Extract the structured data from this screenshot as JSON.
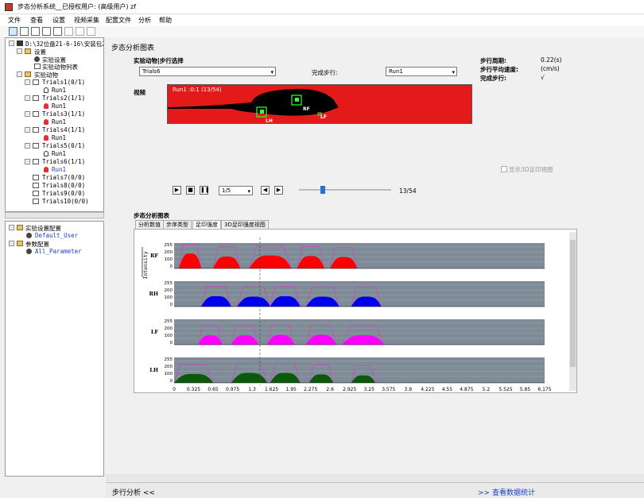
{
  "window": {
    "title": "步态分析系统__已授权用户: (高级用户) zf"
  },
  "menu": [
    "文件",
    "查看",
    "设置",
    "视频采集",
    "配置文件",
    "分析",
    "帮助"
  ],
  "tree": {
    "root_path": "D:\\32位盘21-6-16\\安装包21-",
    "settings": "设置",
    "exp_settings": "实验设置",
    "exp_animal_list": "实验动物列表",
    "exp_animals": "实验动物",
    "trials": [
      {
        "label": "Trials1(0/1)",
        "run": "Run1",
        "state": "white"
      },
      {
        "label": "Trials2(1/1)",
        "run": "Run1",
        "state": "red"
      },
      {
        "label": "Trials3(1/1)",
        "run": "Run1",
        "state": "red"
      },
      {
        "label": "Trials4(1/1)",
        "run": "Run1",
        "state": "red"
      },
      {
        "label": "Trials5(0/1)",
        "run": "Run1",
        "state": "white"
      },
      {
        "label": "Trials6(1/1)",
        "run": "Run1",
        "state": "red",
        "selected": true
      }
    ],
    "trials_empty": [
      "Trials7(0/0)",
      "Trials8(0/0)",
      "Trials9(0/0)",
      "Trials10(0/0)"
    ]
  },
  "tree2": {
    "exp_config": "实验设置配置",
    "default_user": "Default_User",
    "param_config": "参数配置",
    "all_param": "All_Parameter"
  },
  "main": {
    "section_title": "步态分析图表",
    "animal_label": "实验动物|步行选择",
    "animal_value": "Trials6",
    "finished_label": "完成步行:",
    "finished_value": "Run1",
    "stats": [
      {
        "label": "步行周期:",
        "value": "0.22(s)"
      },
      {
        "label": "步行平均速度:",
        "value": "(cm/s)"
      },
      {
        "label": "完成步行:",
        "value": "√"
      }
    ],
    "video_label": "视频",
    "video_caption": "Run1 :0:1 (13/54)",
    "paw_labels": [
      "RF",
      "LH",
      "LF"
    ],
    "show_3d": "显示3D足印视图",
    "speed_value": "1/5",
    "frame_counter": "13/54",
    "progress": 0.23,
    "chart_section": "步态分析图表",
    "tabs": [
      "分析数值",
      "步序类型",
      "足印强度",
      "3D足印强度视图"
    ],
    "active_tab": 2
  },
  "status": {
    "left": "步行分析 <<",
    "right": ">> 查看数据统计"
  },
  "chart_data": {
    "type": "area",
    "ylabel": "Intensity",
    "yticks": [
      "255",
      "200",
      "100",
      "0"
    ],
    "x_ticks": [
      "0",
      "0.325",
      "0.65",
      "0.975",
      "1.3",
      "1.625",
      "1.95",
      "2.275",
      "2.6",
      "2.925",
      "3.25",
      "3.575",
      "3.9",
      "4.225",
      "4.55",
      "4.875",
      "5.2",
      "5.525",
      "5.85",
      "6.175"
    ],
    "xlim": [
      0,
      6.175
    ],
    "marker_x": 1.43,
    "colors": {
      "RF": "#ff0000",
      "RH": "#0000ee",
      "LF": "#ff00ff",
      "LH": "#0b5a0b",
      "bg": "#7f8c97",
      "envelope": "#cc44cc"
    },
    "series": [
      {
        "name": "RF",
        "contacts": [
          [
            0.08,
            0.45,
            150
          ],
          [
            0.65,
            1.1,
            120
          ],
          [
            1.25,
            1.95,
            130
          ],
          [
            2.05,
            2.5,
            125
          ],
          [
            2.6,
            3.05,
            115
          ]
        ]
      },
      {
        "name": "RH",
        "contacts": [
          [
            0.45,
            0.95,
            105
          ],
          [
            1.05,
            1.6,
            100
          ],
          [
            1.6,
            2.1,
            105
          ],
          [
            2.2,
            2.75,
            100
          ],
          [
            2.95,
            3.45,
            100
          ]
        ]
      },
      {
        "name": "LF",
        "contacts": [
          [
            0.4,
            0.8,
            95
          ],
          [
            0.95,
            1.4,
            95
          ],
          [
            1.55,
            2.0,
            100
          ],
          [
            2.2,
            2.7,
            100
          ],
          [
            2.8,
            3.5,
            95
          ]
        ]
      },
      {
        "name": "LH",
        "contacts": [
          [
            0.0,
            0.65,
            90
          ],
          [
            0.95,
            1.55,
            100
          ],
          [
            1.6,
            2.1,
            100
          ],
          [
            2.25,
            2.65,
            85
          ],
          [
            2.95,
            3.35,
            75
          ]
        ]
      }
    ]
  }
}
